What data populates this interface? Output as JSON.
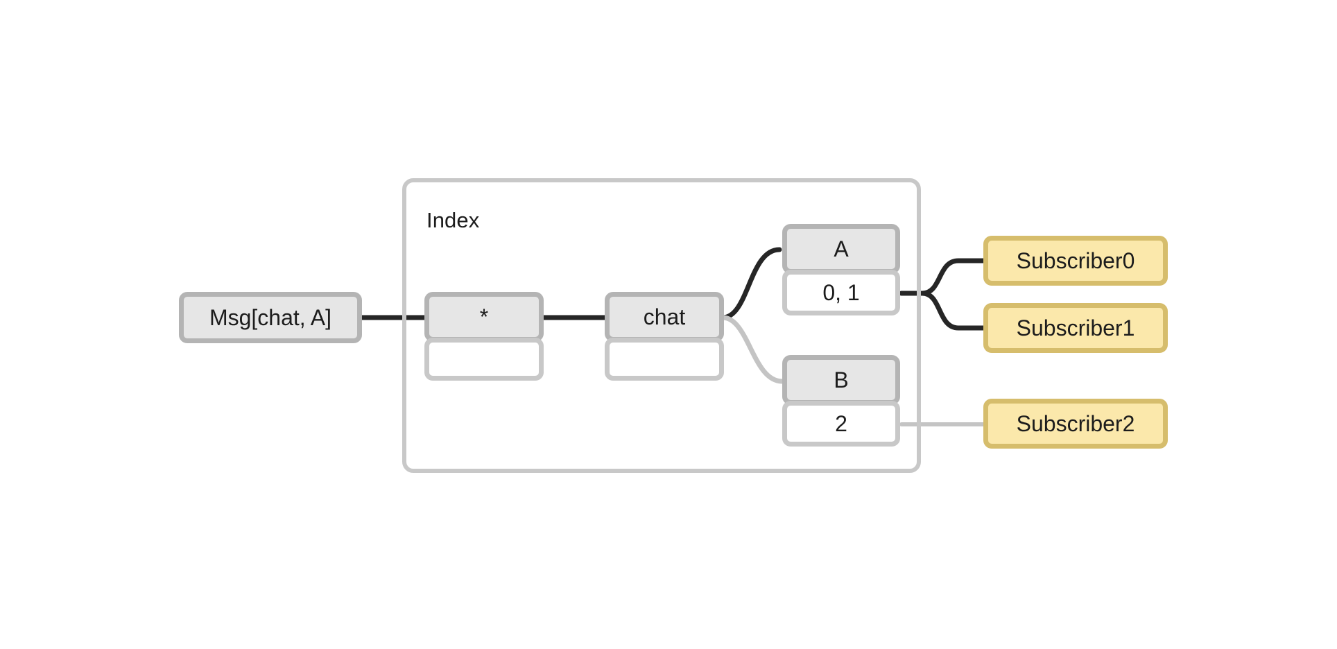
{
  "diagram": {
    "title_label": "Index",
    "background_color": "#ffffff",
    "colors": {
      "node_header_fill": "#e6e6e6",
      "node_header_border": "#b4b4b4",
      "node_body_fill": "#ffffff",
      "node_body_border": "#c8c8c8",
      "subscriber_fill": "#fbe8ab",
      "subscriber_border": "#d6bd6c",
      "group_border": "#c8c8c8",
      "edge_active": "#262626",
      "edge_inactive": "#c4c4c4",
      "text": "#1c1c1c"
    },
    "message": {
      "label": "Msg[chat, A]"
    },
    "index": {
      "label": "Index",
      "nodes": [
        {
          "id": "wildcard",
          "header": "*",
          "body": ""
        },
        {
          "id": "chat",
          "header": "chat",
          "body": ""
        },
        {
          "id": "a",
          "header": "A",
          "body": "0, 1"
        },
        {
          "id": "b",
          "header": "B",
          "body": "2"
        }
      ]
    },
    "subscribers": [
      {
        "id": "sub0",
        "label": "Subscriber0"
      },
      {
        "id": "sub1",
        "label": "Subscriber1"
      },
      {
        "id": "sub2",
        "label": "Subscriber2"
      }
    ],
    "edges": [
      {
        "id": "msg-to-wildcard",
        "from": "Msg[chat, A]",
        "to": "*",
        "state": "active"
      },
      {
        "id": "wildcard-to-chat",
        "from": "*",
        "to": "chat",
        "state": "active"
      },
      {
        "id": "chat-to-a",
        "from": "chat",
        "to": "A",
        "state": "active"
      },
      {
        "id": "chat-to-b",
        "from": "chat",
        "to": "B",
        "state": "inactive"
      },
      {
        "id": "a-to-sub0",
        "from": "0, 1",
        "to": "Subscriber0",
        "state": "active"
      },
      {
        "id": "a-to-sub1",
        "from": "0, 1",
        "to": "Subscriber1",
        "state": "active"
      },
      {
        "id": "b-to-sub2",
        "from": "2",
        "to": "Subscriber2",
        "state": "inactive"
      }
    ]
  }
}
